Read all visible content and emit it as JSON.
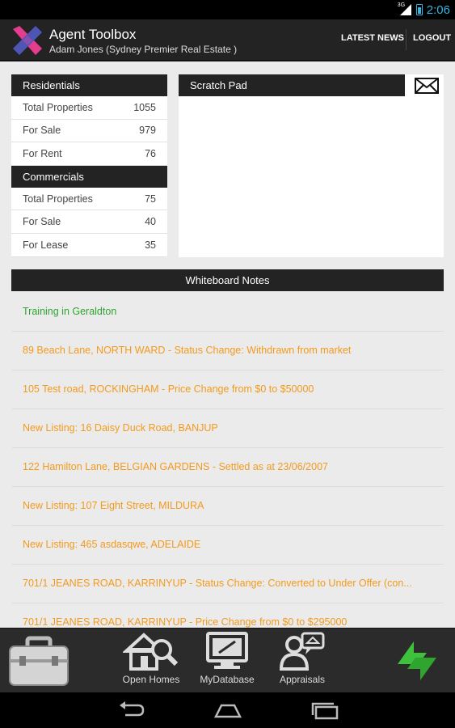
{
  "status_bar": {
    "time": "2:06",
    "signal_label": "3G",
    "icons": [
      "signal-icon",
      "battery-icon"
    ]
  },
  "header": {
    "title": "Agent Toolbox",
    "subtitle": "Adam Jones (Sydney Premier Real Estate )",
    "actions": {
      "latest_news": "LATEST NEWS",
      "logout": "LOGOUT"
    }
  },
  "stats": {
    "residentials": {
      "title": "Residentials",
      "rows": [
        {
          "label": "Total Properties",
          "value": "1055"
        },
        {
          "label": "For Sale",
          "value": "979"
        },
        {
          "label": "For Rent",
          "value": "76"
        }
      ]
    },
    "commercials": {
      "title": "Commercials",
      "rows": [
        {
          "label": "Total Properties",
          "value": "75"
        },
        {
          "label": "For Sale",
          "value": "40"
        },
        {
          "label": "For Lease",
          "value": "35"
        }
      ]
    }
  },
  "scratch_pad": {
    "title": "Scratch Pad",
    "content": ""
  },
  "whiteboard": {
    "title": "Whiteboard Notes",
    "notes": [
      "Training in Geraldton",
      "89 Beach Lane, NORTH WARD - Status Change: Withdrawn from market",
      "105 Test road, ROCKINGHAM - Price Change from $0 to $50000",
      "New Listing: 16 Daisy Duck Road, BANJUP",
      "122 Hamilton Lane, BELGIAN GARDENS - Settled as at 23/06/2007",
      "New Listing: 107 Eight Street, MILDURA",
      "New Listing: 465 asdasqwe, ADELAIDE",
      "701/1 JEANES ROAD, KARRINYUP - Status Change: Converted to Under Offer (con...",
      "701/1 JEANES ROAD, KARRINYUP - Price Change from $0 to $295000"
    ]
  },
  "toolbar": {
    "open_homes": "Open Homes",
    "my_database": "MyDatabase",
    "appraisals": "Appraisals"
  },
  "colors": {
    "accent_green": "#2fa42f",
    "note_orange": "#f39a1d",
    "status_blue": "#33b5e5",
    "dark_bar": "#232323"
  }
}
